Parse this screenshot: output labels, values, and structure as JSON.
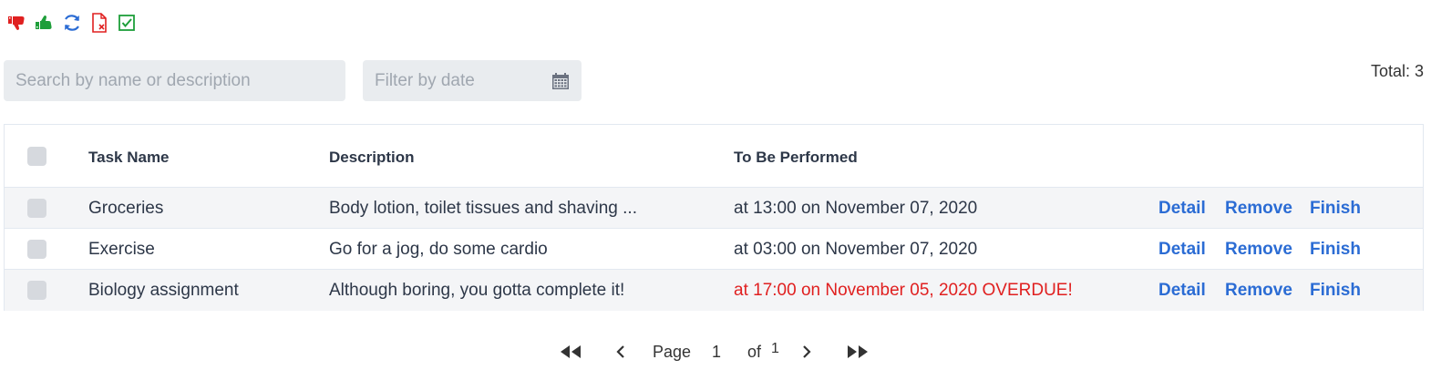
{
  "toolbar": {
    "icons": [
      "thumbs-down-icon",
      "thumbs-up-icon",
      "refresh-icon",
      "delete-file-icon",
      "check-square-icon"
    ],
    "colors": {
      "red": "#e02020",
      "green": "#1e9e3a",
      "blue": "#2b6cd4"
    }
  },
  "filters": {
    "search_placeholder": "Search by name or description",
    "date_placeholder": "Filter by date"
  },
  "total_label": "Total: 3",
  "table": {
    "headers": {
      "name": "Task Name",
      "description": "Description",
      "when": "To Be Performed"
    },
    "rows": [
      {
        "name": "Groceries",
        "description": "Body lotion, toilet tissues and shaving ...",
        "when": "at 13:00 on November 07, 2020",
        "overdue": false
      },
      {
        "name": "Exercise",
        "description": "Go for a jog, do some cardio",
        "when": "at 03:00 on November 07, 2020",
        "overdue": false
      },
      {
        "name": "Biology assignment",
        "description": "Although boring, you gotta complete it!",
        "when": "at 17:00 on November 05, 2020 OVERDUE!",
        "overdue": true
      }
    ],
    "actions": {
      "detail": "Detail",
      "remove": "Remove",
      "finish": "Finish"
    },
    "link_color": "#2b6cd4",
    "overdue_color": "#e02020"
  },
  "pagination": {
    "page_label": "Page",
    "current_page": "1",
    "of_label": "of",
    "total_pages": "1"
  }
}
